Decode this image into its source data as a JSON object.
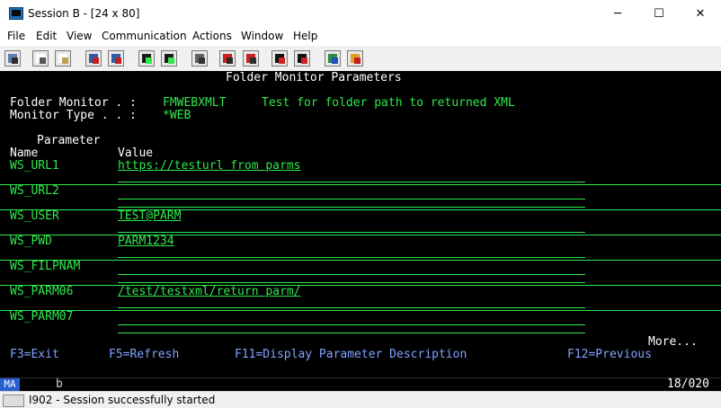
{
  "window": {
    "title": "Session B - [24 x 80]",
    "minimize": "─",
    "maximize": "☐",
    "close": "✕"
  },
  "menubar": [
    "File",
    "Edit",
    "View",
    "Communication",
    "Actions",
    "Window",
    "Help"
  ],
  "toolbar_icons": [
    "print-icon",
    "copy-icon",
    "paste-icon",
    "send-icon",
    "receive-icon",
    "display-icon",
    "screen-icon",
    "keyboard-icon",
    "macro-record-icon",
    "macro-stop-icon",
    "macro-play-icon",
    "macro-icon",
    "globe-icon",
    "edit-icon"
  ],
  "screen": {
    "title": "Folder Monitor Parameters",
    "folder_monitor_label": "Folder Monitor . :",
    "folder_monitor_value": "FMWEBXMLT",
    "folder_monitor_desc": "Test for folder path to returned XML",
    "monitor_type_label": "Monitor Type . . :",
    "monitor_type_value": "*WEB",
    "col_parameter": "Parameter",
    "col_name": "Name",
    "col_value": "Value",
    "rows": [
      {
        "name": "WS_URL1",
        "value": "https://testurl from parms"
      },
      {
        "name": "WS_URL2",
        "value": ""
      },
      {
        "name": "WS_USER",
        "value": "TEST@PARM"
      },
      {
        "name": "WS_PWD",
        "value": "PARM1234"
      },
      {
        "name": "WS_FILPNAM",
        "value": ""
      },
      {
        "name": "WS_PARM06",
        "value": "/test/testxml/return parm/"
      },
      {
        "name": "WS_PARM07",
        "value": ""
      }
    ],
    "more": "More...",
    "fkeys": [
      "F3=Exit",
      "F5=Refresh",
      "F11=Display Parameter Description",
      "F12=Previous"
    ]
  },
  "oia": {
    "indicator": "MA",
    "session": "b",
    "cursor": "18/020"
  },
  "status": {
    "text": "I902 - Session successfully started"
  },
  "colors": {
    "screen_bg": "#000000",
    "field_green": "#2ee84c",
    "title_white": "#ffffff",
    "fkey_blue": "#7fa3ff"
  }
}
